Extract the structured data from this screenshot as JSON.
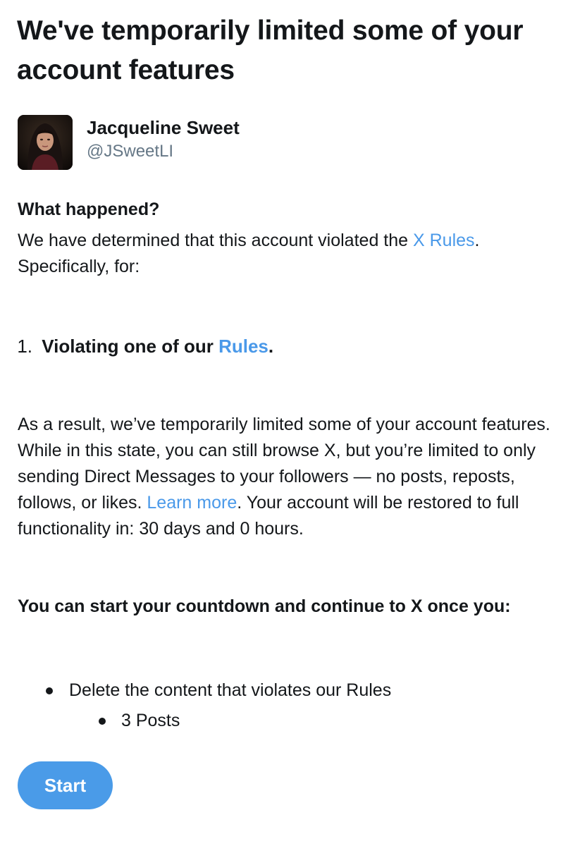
{
  "header": {
    "title": "We've temporarily limited some of your account features"
  },
  "profile": {
    "display_name": "Jacqueline Sweet",
    "handle": "@JSweetLI",
    "avatar_icon": "profile-photo"
  },
  "what_happened": {
    "heading": "What happened?",
    "text_before_link": "We have determined that this account violated the ",
    "rules_link": "X Rules",
    "text_after_link": ".",
    "specifically": "Specifically, for:"
  },
  "violations": [
    {
      "number": "1.",
      "text_before_link": "Violating one of our ",
      "link": "Rules",
      "text_after_link": "."
    }
  ],
  "result": {
    "text_before_link": "As a result, we’ve temporarily limited some of your account features. While in this state, you can still browse X, but you’re limited to only sending Direct Messages to your followers — no posts, reposts, follows, or likes. ",
    "learn_more_link": "Learn more",
    "text_after_link": ". Your account will be restored to full functionality in: 30 days and 0 hours."
  },
  "countdown": {
    "heading": "You can start your countdown and continue to X once you:",
    "tasks": [
      {
        "label": "Delete the content that violates our Rules",
        "subitems": [
          "3 Posts"
        ]
      }
    ]
  },
  "actions": {
    "start_label": "Start"
  },
  "colors": {
    "link": "#4a99e9",
    "button": "#4a9be8",
    "text": "#14171a",
    "muted": "#657786"
  }
}
